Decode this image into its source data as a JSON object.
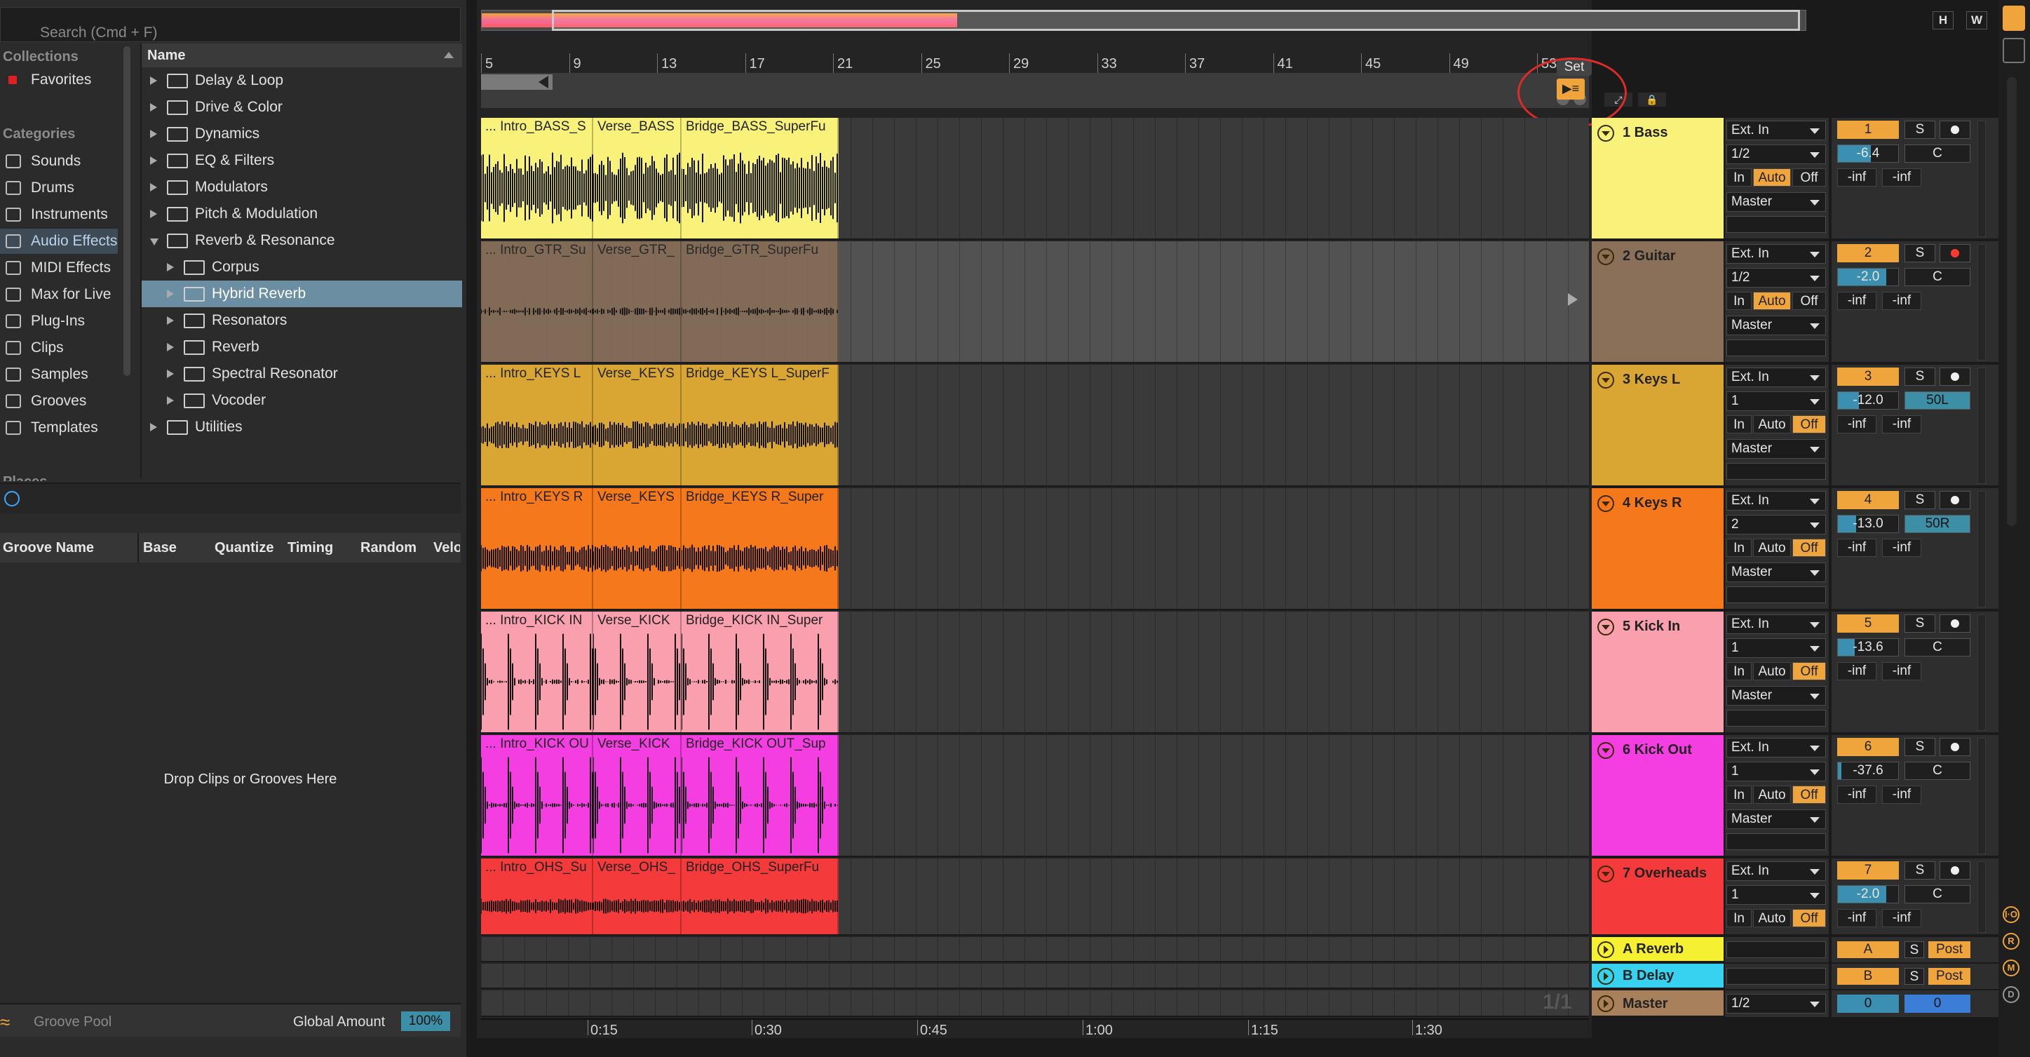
{
  "search": {
    "placeholder": "Search (Cmd + F)"
  },
  "sidebar": {
    "collections_head": "Collections",
    "favorites": "Favorites",
    "categories_head": "Categories",
    "items": [
      "Sounds",
      "Drums",
      "Instruments",
      "Audio Effects",
      "MIDI Effects",
      "Max for Live",
      "Plug-Ins",
      "Clips",
      "Samples",
      "Grooves",
      "Templates"
    ],
    "places_head": "Places"
  },
  "browser": {
    "name_header": "Name",
    "rows": [
      {
        "label": "Delay & Loop",
        "level": 0,
        "open": false
      },
      {
        "label": "Drive & Color",
        "level": 0,
        "open": false
      },
      {
        "label": "Dynamics",
        "level": 0,
        "open": false
      },
      {
        "label": "EQ & Filters",
        "level": 0,
        "open": false
      },
      {
        "label": "Modulators",
        "level": 0,
        "open": false
      },
      {
        "label": "Pitch & Modulation",
        "level": 0,
        "open": false
      },
      {
        "label": "Reverb & Resonance",
        "level": 0,
        "open": true
      },
      {
        "label": "Corpus",
        "level": 1,
        "open": false
      },
      {
        "label": "Hybrid Reverb",
        "level": 1,
        "open": false
      },
      {
        "label": "Resonators",
        "level": 1,
        "open": false
      },
      {
        "label": "Reverb",
        "level": 1,
        "open": false
      },
      {
        "label": "Spectral Resonator",
        "level": 1,
        "open": false
      },
      {
        "label": "Vocoder",
        "level": 1,
        "open": false
      },
      {
        "label": "Utilities",
        "level": 0,
        "open": false
      }
    ]
  },
  "groove": {
    "columns": [
      "Groove Name",
      "Base",
      "Quantize",
      "Timing",
      "Random",
      "Velo"
    ],
    "drop_text": "Drop Clips or Grooves Here",
    "footer_label": "Groove Pool",
    "global_amount_label": "Global Amount",
    "global_amount_value": "100%"
  },
  "overview": {
    "h_label": "H",
    "w_label": "W"
  },
  "ruler": {
    "bars": [
      "5",
      "9",
      "13",
      "17",
      "21",
      "25",
      "29",
      "33",
      "37",
      "41",
      "45",
      "49",
      "53"
    ],
    "set_label": "Set"
  },
  "time_ruler": {
    "labels": [
      "0:15",
      "0:30",
      "0:45",
      "1:00",
      "1:15",
      "1:30"
    ]
  },
  "page_indicator": "1/1",
  "colors": {
    "bass": "#f9f27a",
    "guitar": "#8a7058",
    "keys_l": "#d9a633",
    "keys_r": "#f5781a",
    "kick_in": "#f99fae",
    "kick_out": "#f43ee2",
    "overheads": "#f43a3a",
    "accent": "#f0a53c"
  },
  "tracks": [
    {
      "name": "1 Bass",
      "num": "1",
      "input": "Ext. In",
      "channel": "1/2",
      "monitor": "Auto",
      "volume": "-6.4",
      "vol_fill": 0.55,
      "pan": "C",
      "pan_hi": false,
      "armed": false,
      "clips": [
        "... Intro_BASS_S",
        "Verse_BASS",
        "Bridge_BASS_SuperFu"
      ]
    },
    {
      "name": "2 Guitar",
      "num": "2",
      "input": "Ext. In",
      "channel": "1/2",
      "monitor": "Auto",
      "volume": "-2.0",
      "vol_fill": 0.8,
      "pan": "C",
      "pan_hi": false,
      "armed": true,
      "clips": [
        "... Intro_GTR_Su",
        "Verse_GTR_",
        "Bridge_GTR_SuperFu"
      ]
    },
    {
      "name": "3 Keys L",
      "num": "3",
      "input": "Ext. In",
      "channel": "1",
      "monitor": "Off",
      "volume": "-12.0",
      "vol_fill": 0.35,
      "pan": "50L",
      "pan_hi": true,
      "armed": false,
      "clips": [
        "... Intro_KEYS L",
        "Verse_KEYS",
        "Bridge_KEYS L_SuperF"
      ]
    },
    {
      "name": "4 Keys R",
      "num": "4",
      "input": "Ext. In",
      "channel": "2",
      "monitor": "Off",
      "volume": "-13.0",
      "vol_fill": 0.3,
      "pan": "50R",
      "pan_hi": true,
      "armed": false,
      "clips": [
        "... Intro_KEYS R",
        "Verse_KEYS",
        "Bridge_KEYS R_Super"
      ]
    },
    {
      "name": "5 Kick In",
      "num": "5",
      "input": "Ext. In",
      "channel": "1",
      "monitor": "Off",
      "volume": "-13.6",
      "vol_fill": 0.28,
      "pan": "C",
      "pan_hi": false,
      "armed": false,
      "clips": [
        "... Intro_KICK IN",
        "Verse_KICK",
        "Bridge_KICK IN_Super"
      ]
    },
    {
      "name": "6 Kick Out",
      "num": "6",
      "input": "Ext. In",
      "channel": "1",
      "monitor": "Off",
      "volume": "-37.6",
      "vol_fill": 0.06,
      "pan": "C",
      "pan_hi": false,
      "armed": false,
      "clips": [
        "... Intro_KICK OU",
        "Verse_KICK",
        "Bridge_KICK OUT_Sup"
      ]
    },
    {
      "name": "7 Overheads",
      "num": "7",
      "input": "Ext. In",
      "channel": "1",
      "monitor": "Off",
      "volume": "-2.0",
      "vol_fill": 0.8,
      "pan": "C",
      "pan_hi": false,
      "armed": false,
      "clips": [
        "... Intro_OHS_Su",
        "Verse_OHS_",
        "Bridge_OHS_SuperFu"
      ]
    }
  ],
  "io_labels": {
    "in": "In",
    "auto": "Auto",
    "off": "Off",
    "output": "Master",
    "inf": "-inf",
    "solo": "S"
  },
  "returns": [
    {
      "name": "A Reverb",
      "letter": "A",
      "post": "Post",
      "color": "#f5f032"
    },
    {
      "name": "B Delay",
      "letter": "B",
      "post": "Post",
      "color": "#36d2f0"
    }
  ],
  "master": {
    "name": "Master",
    "channel": "1/2",
    "num": "0",
    "vol": "0"
  }
}
